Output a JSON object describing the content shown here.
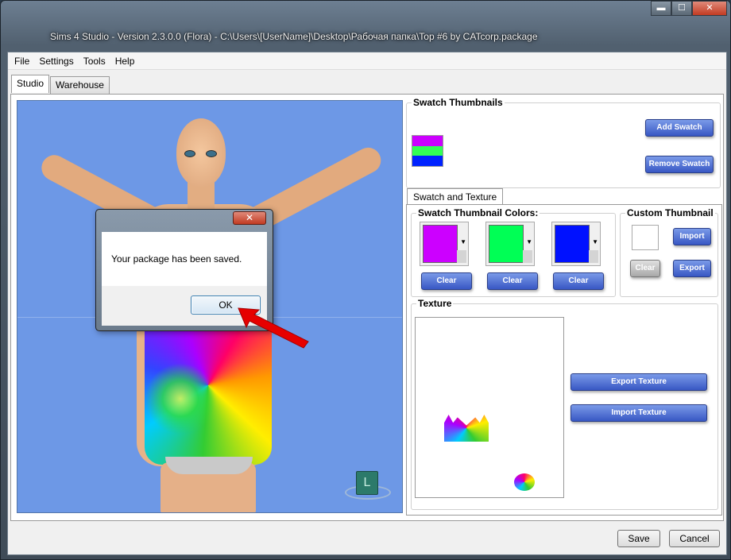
{
  "window": {
    "title": "Sims 4 Studio - Version 2.3.0.0  (Flora)   - C:\\Users\\[UserName]\\Desktop\\Рабочая папка\\Top #6 by CATcorp.package",
    "min_label": "▬",
    "max_label": "☐",
    "close_label": "✕"
  },
  "menu": {
    "items": [
      "File",
      "Settings",
      "Tools",
      "Help"
    ]
  },
  "tabs": [
    "Studio",
    "Warehouse"
  ],
  "swatch_thumbnails": {
    "title": "Swatch Thumbnails",
    "add_label": "Add Swatch",
    "remove_label": "Remove Swatch",
    "strip_colors": [
      "#cc00ff",
      "#33ff55",
      "#0022ff"
    ]
  },
  "swatch_texture_tab": "Swatch and Texture",
  "swatch_colors": {
    "title": "Swatch Thumbnail Colors:",
    "colors": [
      "#cc00ff",
      "#00ff55",
      "#0011ff"
    ],
    "clear_label": "Clear"
  },
  "custom_thumbnail": {
    "title": "Custom Thumbnail",
    "import_label": "Import",
    "clear_label": "Clear",
    "export_label": "Export"
  },
  "texture": {
    "title": "Texture",
    "export_label": "Export Texture",
    "import_label": "Import Texture"
  },
  "footer": {
    "save_label": "Save",
    "cancel_label": "Cancel"
  },
  "viewport": {
    "lod_label": "L"
  },
  "dialog": {
    "message": "Your package has been saved.",
    "ok_label": "OK",
    "close_label": "✕"
  }
}
